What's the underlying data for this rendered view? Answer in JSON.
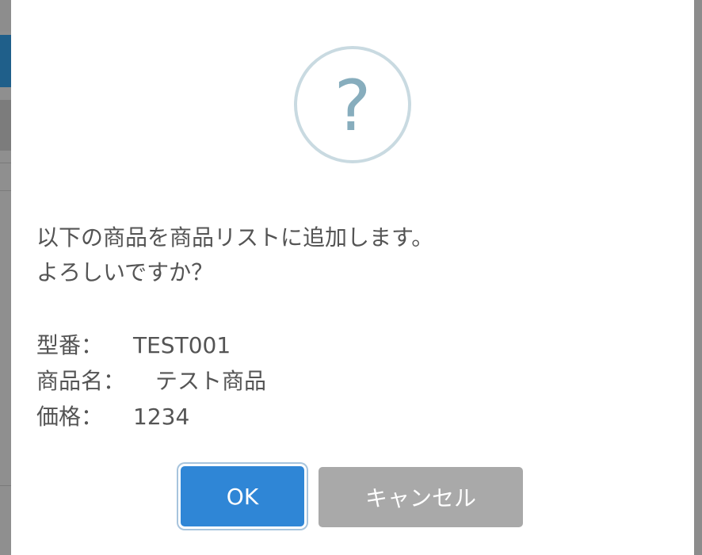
{
  "dialog": {
    "icon": "question-icon",
    "icon_glyph": "?",
    "message_lines": [
      "以下の商品を商品リストに追加します。",
      "よろしいですか？"
    ],
    "details": [
      {
        "label": "型番：",
        "value": "TEST001"
      },
      {
        "label": "商品名：",
        "value": "テスト商品"
      },
      {
        "label": "価格：",
        "value": "1234"
      }
    ],
    "buttons": {
      "ok_label": "OK",
      "cancel_label": "キャンセル"
    }
  },
  "colors": {
    "ok_button": "#2f86d6",
    "cancel_button": "#a9a9a9",
    "icon_ring": "#c9dae1",
    "icon_glyph": "#87adbd",
    "text": "#545454"
  }
}
